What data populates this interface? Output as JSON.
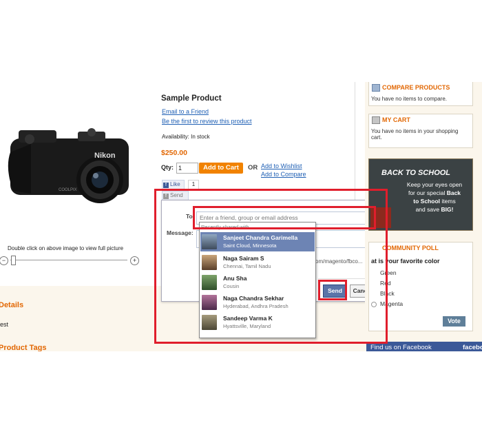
{
  "product": {
    "title": "Sample Product",
    "email_friend": "Email to a Friend",
    "review_link": "Be the first to review this product",
    "availability": "Availability: In stock",
    "price": "$250.00",
    "qty_label": "Qty:",
    "qty_value": "1",
    "add_to_cart": "Add to Cart",
    "or_label": "OR",
    "add_to_wishlist": "Add to Wishlist",
    "add_to_compare": "Add to Compare",
    "image_hint": "Double click on above image to view full picture",
    "zoom_minus": "−",
    "zoom_plus": "+"
  },
  "facebook": {
    "like_label": "Like",
    "like_count": "1",
    "send_label": "Send",
    "to_label": "To:",
    "message_label": "Message:",
    "to_placeholder": "Enter a friend, group or email address",
    "link_fragment": "om/magento/fbco...",
    "send_button": "Send",
    "cancel_button": "Cancel",
    "recent_header": "Recently shared with",
    "suggestions": [
      {
        "name": "Sanjeet Chandra Garimella",
        "location": "Saint Cloud, Minnesota",
        "selected": true
      },
      {
        "name": "Naga Sairam S",
        "location": "Chennai, Tamil Nadu",
        "selected": false
      },
      {
        "name": "Anu Sha",
        "location": "Cousin",
        "selected": false
      },
      {
        "name": "Naga Chandra Sekhar",
        "location": "Hyderabad, Andhra Pradesh",
        "selected": false
      },
      {
        "name": "Sandeep Varma K",
        "location": "Hyattsville, Maryland",
        "selected": false
      }
    ]
  },
  "tabs": {
    "details": "Details",
    "details_text": "est",
    "product_tags": "Product Tags"
  },
  "sidebar": {
    "compare_title": "COMPARE PRODUCTS",
    "compare_text": "You have no items to compare.",
    "cart_title": "MY CART",
    "cart_text": "You have no items in your shopping cart.",
    "banner_title": "BACK TO SCHOOL",
    "banner_text_1": "Keep your eyes open",
    "banner_text_2": "for our special",
    "banner_text_bold_1": "Back",
    "banner_text_bold_2": "to School",
    "banner_text_3": "items",
    "banner_text_4": "and save",
    "banner_text_bold_3": "BIG!",
    "poll_title": "COMMUNITY POLL",
    "poll_question": "at is your favorite color",
    "poll_options": [
      "Green",
      "Red",
      "Black",
      "Magenta"
    ],
    "vote_button": "Vote",
    "find_us": "Find us on Facebook",
    "facebook_word": "facebo"
  },
  "colors": {
    "accent_orange": "#e26703",
    "fb_blue": "#3b5998",
    "highlight_red": "#e01e2c",
    "link_blue": "#1e5fb4"
  }
}
